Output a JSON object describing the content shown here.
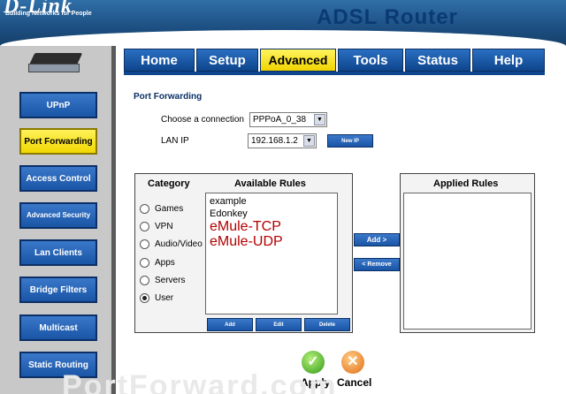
{
  "header": {
    "brand": "D-Link",
    "tagline": "Building Networks for People",
    "product": "ADSL Router"
  },
  "sidebar": {
    "items": [
      {
        "label": "UPnP",
        "active": false
      },
      {
        "label": "Port Forwarding",
        "active": true
      },
      {
        "label": "Access Control",
        "active": false
      },
      {
        "label": "Advanced Security",
        "active": false
      },
      {
        "label": "Lan Clients",
        "active": false
      },
      {
        "label": "Bridge Filters",
        "active": false
      },
      {
        "label": "Multicast",
        "active": false
      },
      {
        "label": "Static Routing",
        "active": false
      }
    ]
  },
  "tabs": [
    {
      "label": "Home",
      "active": false
    },
    {
      "label": "Setup",
      "active": false
    },
    {
      "label": "Advanced",
      "active": true
    },
    {
      "label": "Tools",
      "active": false
    },
    {
      "label": "Status",
      "active": false
    },
    {
      "label": "Help",
      "active": false
    }
  ],
  "main": {
    "title": "Port Forwarding",
    "connection_label": "Choose a connection",
    "connection_value": "PPPoA_0_38",
    "lanip_label": "LAN IP",
    "lanip_value": "192.168.1.2",
    "new_ip_button": "New IP",
    "category_head": "Category",
    "available_head": "Available Rules",
    "applied_head": "Applied Rules",
    "categories": [
      "Games",
      "VPN",
      "Audio/Video",
      "Apps",
      "Servers",
      "User"
    ],
    "selected_category": "User",
    "available_rules": [
      "example",
      "Edonkey",
      "eMule-TCP",
      "eMule-UDP"
    ],
    "add_button": "Add",
    "edit_button": "Edit",
    "delete_button": "Delete",
    "add_arrow_button": "Add >",
    "remove_button": "< Remove",
    "apply_label": "Apply",
    "cancel_label": "Cancel"
  },
  "watermark": "PortForward.com"
}
